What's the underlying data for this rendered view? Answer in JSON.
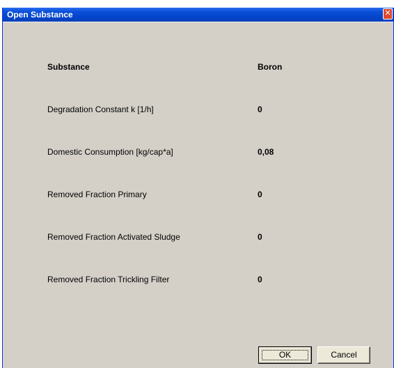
{
  "window": {
    "title": "Open Substance",
    "close_glyph": "✕",
    "title_bar_color": "#0a4fd8",
    "background_color": "#d4d0c8"
  },
  "rows": [
    {
      "label": "Substance",
      "value": "Boron"
    },
    {
      "label": "Degradation Constant k [1/h]",
      "value": "0"
    },
    {
      "label": "Domestic Consumption [kg/cap*a]",
      "value": "0,08"
    },
    {
      "label": "Removed Fraction Primary",
      "value": "0"
    },
    {
      "label": "Removed Fraction Activated Sludge",
      "value": "0"
    },
    {
      "label": "Removed Fraction Trickling Filter",
      "value": "0"
    }
  ],
  "buttons": {
    "ok_label": "OK",
    "cancel_label": "Cancel"
  }
}
